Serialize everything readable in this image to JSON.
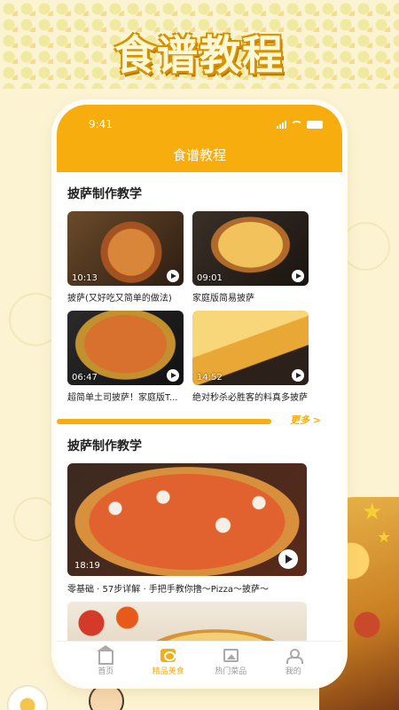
{
  "headline": "食谱教程",
  "status_bar": {
    "time": "9:41"
  },
  "nav": {
    "title": "食谱教程"
  },
  "section1": {
    "title": "披萨制作教学",
    "videos": [
      {
        "duration": "10:13",
        "title": "披萨(又好吃又简单的做法)"
      },
      {
        "duration": "09:01",
        "title": "家庭版简易披萨"
      },
      {
        "duration": "06:47",
        "title": "超简单土司披萨！家庭版T..."
      },
      {
        "duration": "14:52",
        "title": "绝对秒杀必胜客的料真多披萨"
      }
    ],
    "more_label": "更多 >"
  },
  "section2": {
    "title": "披萨制作教学",
    "featured": {
      "duration": "18:19",
      "title": "零基础 · 57步详解 · 手把手教你撸～Pizza～披萨～"
    }
  },
  "tabs": [
    {
      "label": "首页",
      "icon": "home-icon",
      "active": false
    },
    {
      "label": "精品美食",
      "icon": "food-icon",
      "active": true
    },
    {
      "label": "热门菜品",
      "icon": "picture-icon",
      "active": false
    },
    {
      "label": "我的",
      "icon": "user-icon",
      "active": false
    }
  ],
  "colors": {
    "accent": "#f6ad0d",
    "background": "#fbf3d2"
  }
}
